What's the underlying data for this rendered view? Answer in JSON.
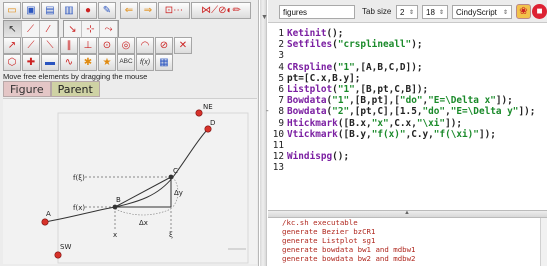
{
  "toolbar": {
    "row1": [
      "folder-open-icon",
      "save-icon",
      "save-as-icon",
      "export-icon",
      "record-icon",
      "pen-icon",
      "undo-icon",
      "redo-icon",
      "add-mode-group",
      "construction-group"
    ],
    "row2": [
      "select-arrow-icon",
      "draw-segment-icon",
      "line-icon",
      "circle-icon",
      "polygon-icon",
      "move-icon"
    ],
    "row3": [
      "add-point-icon",
      "segment-icon",
      "line-through-icon",
      "parallel-icon",
      "perpendicular-icon",
      "compass-circle-icon",
      "circle-center-icon",
      "arc-icon",
      "conic-icon",
      "intersect-icon"
    ],
    "row4": [
      "polygon-free-icon",
      "cross-icon",
      "ruler-icon",
      "locus-icon",
      "gear-animation-icon",
      "star-icon",
      "text-icon",
      "function-icon",
      "chart-icon"
    ],
    "text_button": "ABC",
    "function_button": "f(x)"
  },
  "hint": "Move free elements by dragging the mouse",
  "view_tabs": [
    "Figure",
    "Parent"
  ],
  "canvas": {
    "points": {
      "A": "A",
      "B": "B",
      "C": "C",
      "D": "D",
      "NE": "NE",
      "SW": "SW"
    },
    "labels": {
      "fxi": "f(ξ)",
      "fx": "f(x)",
      "dx": "Δx",
      "dy": "Δy",
      "x": "x",
      "xi": "ξ"
    }
  },
  "editor": {
    "file": "figures",
    "tab_size_label": "Tab size",
    "tab_size_value": "2",
    "font_size_value": "18",
    "language": "CindyScript",
    "icons": [
      "cindy-logo-icon",
      "stop-icon",
      "settings-icon",
      "help-icon"
    ],
    "help": "?",
    "lines": [
      {
        "n": "1",
        "parts": [
          [
            "kw",
            "Ketinit"
          ],
          [
            "ids",
            "();"
          ]
        ]
      },
      {
        "n": "2",
        "parts": [
          [
            "kw",
            "Setfiles"
          ],
          [
            "ids",
            "("
          ],
          [
            "str",
            "\"crsplineall\""
          ],
          [
            "ids",
            ");"
          ]
        ]
      },
      {
        "n": "3",
        "parts": []
      },
      {
        "n": "4",
        "parts": [
          [
            "kw",
            "CRspline"
          ],
          [
            "ids",
            "("
          ],
          [
            "str",
            "\"1\""
          ],
          [
            "ids",
            ",[A,B,C,D]);"
          ]
        ]
      },
      {
        "n": "5",
        "parts": [
          [
            "ids",
            "pt=[C.x,B.y];"
          ]
        ]
      },
      {
        "n": "6",
        "parts": [
          [
            "kw",
            "Listplot"
          ],
          [
            "ids",
            "("
          ],
          [
            "str",
            "\"1\""
          ],
          [
            "ids",
            ",[B,pt,C,B]);"
          ]
        ]
      },
      {
        "n": "7",
        "parts": [
          [
            "kw",
            "Bowdata"
          ],
          [
            "ids",
            "("
          ],
          [
            "str",
            "\"1\""
          ],
          [
            "ids",
            ",[B,pt],["
          ],
          [
            "str",
            "\"do\""
          ],
          [
            "ids",
            ","
          ],
          [
            "str",
            "\"E=\\Delta x\""
          ],
          [
            "ids",
            "]);"
          ]
        ]
      },
      {
        "n": "8",
        "parts": [
          [
            "kw",
            "Bowdata"
          ],
          [
            "ids",
            "("
          ],
          [
            "str",
            "\"2\""
          ],
          [
            "ids",
            ",[pt,C],[1.5,"
          ],
          [
            "str",
            "\"do\""
          ],
          [
            "ids",
            ","
          ],
          [
            "str",
            "\"E=\\Delta y\""
          ],
          [
            "ids",
            "]);"
          ]
        ]
      },
      {
        "n": "9",
        "parts": [
          [
            "kw",
            "Htickmark"
          ],
          [
            "ids",
            "([B.x,"
          ],
          [
            "str",
            "\"x\""
          ],
          [
            "ids",
            ",C.x,"
          ],
          [
            "str",
            "\"\\xi\""
          ],
          [
            "ids",
            "]);"
          ]
        ]
      },
      {
        "n": "10",
        "parts": [
          [
            "kw",
            "Vtickmark"
          ],
          [
            "ids",
            "([B.y,"
          ],
          [
            "str",
            "\"f(x)\""
          ],
          [
            "ids",
            ",C.y,"
          ],
          [
            "str",
            "\"f(\\xi)\""
          ],
          [
            "ids",
            "]);"
          ]
        ]
      },
      {
        "n": "11",
        "parts": []
      },
      {
        "n": "12",
        "parts": [
          [
            "kw",
            "Windispg"
          ],
          [
            "ids",
            "();"
          ]
        ]
      },
      {
        "n": "13",
        "parts": []
      }
    ],
    "fold_marker": "-"
  },
  "console": [
    "/kc.sh executable",
    "generate Bezier bzCR1",
    "generate Listplot sg1",
    "generate bowdata bw1 and mdbw1",
    "generate bowdata bw2 and mdbw2"
  ]
}
